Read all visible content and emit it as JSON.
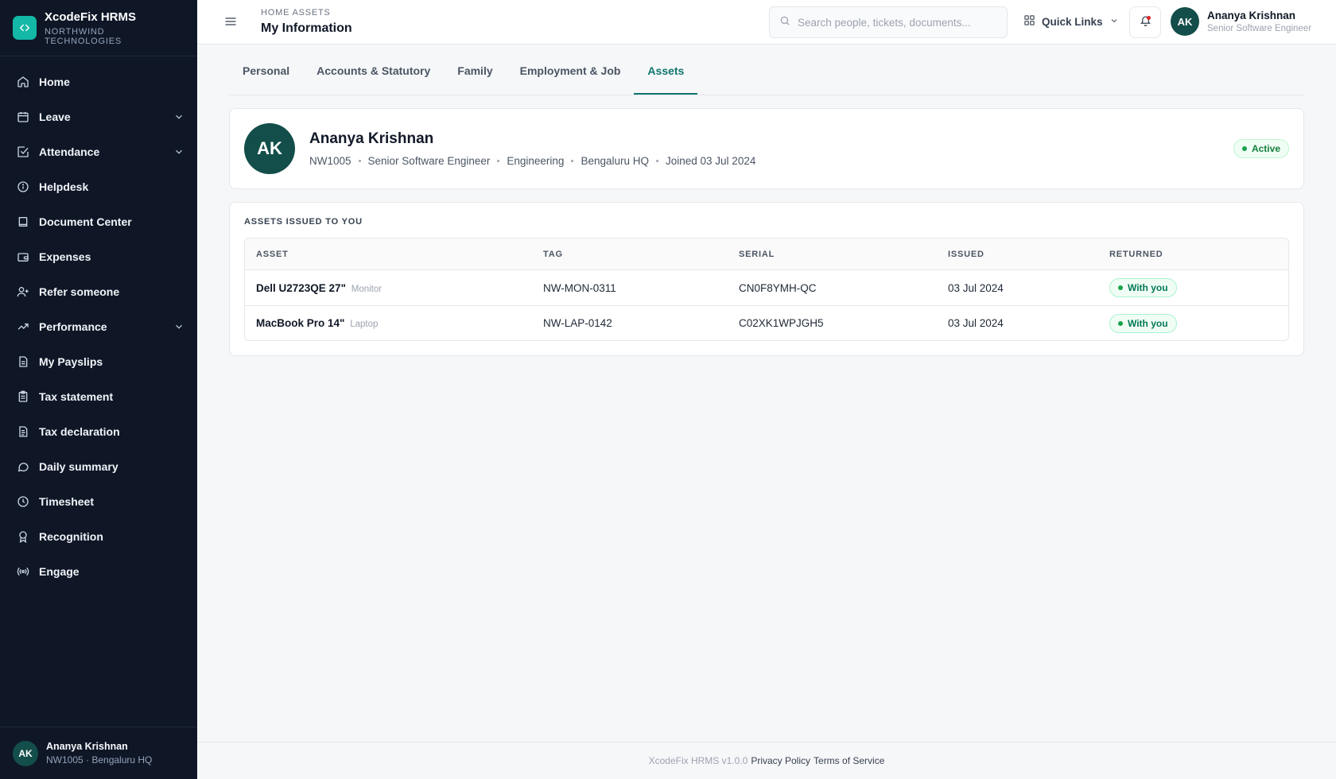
{
  "brand": {
    "name": "XcodeFix HRMS",
    "company": "NORTHWIND TECHNOLOGIES"
  },
  "sidebar": {
    "items": [
      {
        "label": "Home",
        "icon": "home-icon",
        "expandable": false
      },
      {
        "label": "Leave",
        "icon": "calendar-icon",
        "expandable": true
      },
      {
        "label": "Attendance",
        "icon": "check-square-icon",
        "expandable": true
      },
      {
        "label": "Helpdesk",
        "icon": "info-icon",
        "expandable": false
      },
      {
        "label": "Document Center",
        "icon": "book-icon",
        "expandable": false
      },
      {
        "label": "Expenses",
        "icon": "wallet-icon",
        "expandable": false
      },
      {
        "label": "Refer someone",
        "icon": "user-plus-icon",
        "expandable": false
      },
      {
        "label": "Performance",
        "icon": "trending-up-icon",
        "expandable": true
      },
      {
        "label": "My Payslips",
        "icon": "file-icon",
        "expandable": false
      },
      {
        "label": "Tax statement",
        "icon": "clipboard-icon",
        "expandable": false
      },
      {
        "label": "Tax declaration",
        "icon": "file-text-icon",
        "expandable": false
      },
      {
        "label": "Daily summary",
        "icon": "message-circle-icon",
        "expandable": false
      },
      {
        "label": "Timesheet",
        "icon": "clock-icon",
        "expandable": false
      },
      {
        "label": "Recognition",
        "icon": "award-icon",
        "expandable": false
      },
      {
        "label": "Engage",
        "icon": "broadcast-icon",
        "expandable": false
      }
    ],
    "footer": {
      "initials": "AK",
      "name": "Ananya Krishnan",
      "sub": "NW1005 · Bengaluru HQ"
    }
  },
  "topbar": {
    "breadcrumb": "HOME ASSETS",
    "title": "My Information",
    "search_placeholder": "Search people, tickets, documents...",
    "quick_links": "Quick Links",
    "user": {
      "initials": "AK",
      "name": "Ananya Krishnan",
      "role": "Senior Software Engineer"
    }
  },
  "tabs": [
    {
      "label": "Personal",
      "active": false
    },
    {
      "label": "Accounts & Statutory",
      "active": false
    },
    {
      "label": "Family",
      "active": false
    },
    {
      "label": "Employment & Job",
      "active": false
    },
    {
      "label": "Assets",
      "active": true
    }
  ],
  "profile": {
    "initials": "AK",
    "name": "Ananya Krishnan",
    "meta": [
      "NW1005",
      "Senior Software Engineer",
      "Engineering",
      "Bengaluru HQ",
      "Joined 03 Jul 2024"
    ],
    "status": "Active"
  },
  "assets": {
    "section_title": "ASSETS ISSUED TO YOU",
    "columns": [
      "ASSET",
      "TAG",
      "SERIAL",
      "ISSUED",
      "RETURNED"
    ],
    "rows": [
      {
        "name": "Dell U2723QE 27\"",
        "type": "Monitor",
        "tag": "NW-MON-0311",
        "serial": "CN0F8YMH-QC",
        "issued": "03 Jul 2024",
        "returned": "With you"
      },
      {
        "name": "MacBook Pro 14\"",
        "type": "Laptop",
        "tag": "NW-LAP-0142",
        "serial": "C02XK1WPJGH5",
        "issued": "03 Jul 2024",
        "returned": "With you"
      }
    ]
  },
  "footer": {
    "version": "XcodeFix HRMS v1.0.0",
    "privacy": "Privacy Policy",
    "terms": "Terms of Service"
  },
  "colors": {
    "sidebar_bg": "#0f1727",
    "accent": "#0f766e",
    "brand_logo": "#14b8a6",
    "status_green": "#16a34a"
  }
}
